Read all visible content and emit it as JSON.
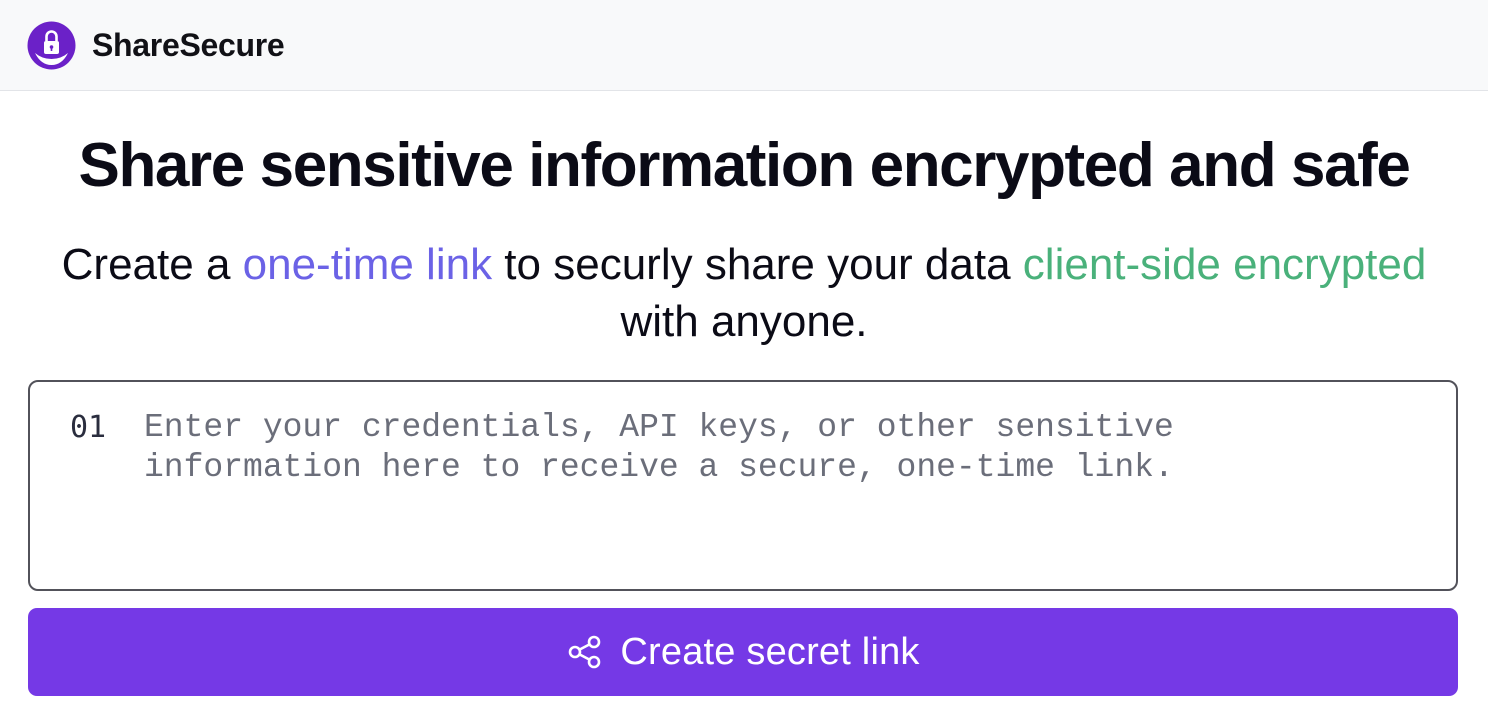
{
  "header": {
    "brand": "ShareSecure",
    "logo_icon": "lock-shield-icon",
    "logo_color": "#6b21c8"
  },
  "hero": {
    "title": "Share sensitive information encrypted and safe",
    "subtitle": {
      "part1": "Create a ",
      "link1": "one-time link",
      "part2": " to securly share your data ",
      "link2": "client-side encrypted",
      "part3": " with anyone."
    }
  },
  "editor": {
    "line_number": "01",
    "placeholder": "Enter your credentials, API keys, or other sensitive information here to receive a secure, one-time link."
  },
  "cta": {
    "label": "Create secret link",
    "icon": "share-icon",
    "color": "#7539e6"
  }
}
